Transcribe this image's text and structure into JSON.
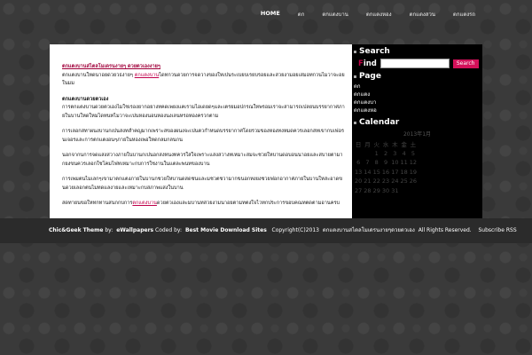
{
  "nav": {
    "items": [
      {
        "label": "HOME"
      },
      {
        "label": "ตก"
      },
      {
        "label": "ตกแตงบาน"
      },
      {
        "label": "ตกแตงหอง"
      },
      {
        "label": "ตกแตงสวน"
      },
      {
        "label": "ตกแตงรถ"
      }
    ]
  },
  "post": {
    "title": "ตกแตงบานสไตลโมเดรนงายๆ ดวยตวเองงายๆ",
    "intro_before": "ตกแตงบานใหดนาอยดวยวธงายๆ ",
    "intro_link": "ตกแตงบาน",
    "intro_after": "ไดทกวนดวยการจดวางของใหเปนระเบยบเรยบรอยและสวยงามอยเสมอทกวนไมวาจะอยในมม",
    "section1_heading": "ตกแตงบานดวยตวเอง",
    "section1_text": "การตกแตงบานดวยตวเองไมใชเรองยากอยางทคดเพยงแคเรามไอเดยดๆและเตรยมอปกรณใหพรอมเราจะสามารถเปลยนบรรยากาศภายในบานใหดใหมไดทนทไมวาจะเปนหองนอนหองนงเลนหรอหองครวกตาม",
    "para2": "การเลอกสทาผนงบานกเปนสงทสำคญมากเพราะสของผนงจะเปนตวกำหนดบรรยากาศโดยรวมของหองทงหมดควรเลอกสทเขากบเฟอรนเจอรและการตกแตงอนๆภายในหองเพอใหดกลมกลนกน",
    "para3": "นอกจากนการจดแสงสวางภายในบานกเปนอกสงหนงทควรใสใจเพราะแสงสวางทเหมาะสมจะชวยใหบานดอบอนนาอยและสบายตามากยงขนควรเลอกใชโคมไฟทเหมาะกบการใชงานในแตละพนทของบาน",
    "para4": "การเพมตนไมเลกๆเขามาตกแตงภายในบานกชวยใหบานดสดชนและมชวตชวามากขนอกทงยงชวยฟอกอากาศภายในบานใหสะอาดขนดวยเลอกตนไมทดแลงายและเหมาะกบสภาพแสงในบาน",
    "para5_before": "สดทายนขอใหทกทานสนกกบการ",
    "para5_link": "ตกแตงบาน",
    "para5_after": "ดวยตวเองและมบานทสวยงามนาอยตามทตงใจไวทกประการขอบคณทตดตามอานครบ"
  },
  "sidebar": {
    "search_title": "Search",
    "find_first": "F",
    "find_rest": "ind",
    "search_button": "Search",
    "page_title": "Page",
    "pages": [
      {
        "label": "ตก"
      },
      {
        "label": "ตกแตง"
      },
      {
        "label": "ตกแตงบา"
      },
      {
        "label": "ตกแตงหอ"
      }
    ],
    "calendar_title": "Calendar",
    "calendar_caption": "2013年1月",
    "weekdays": [
      "日",
      "月",
      "火",
      "水",
      "木",
      "金",
      "土"
    ],
    "weeks": [
      [
        "",
        "",
        "1",
        "2",
        "3",
        "4",
        "5"
      ],
      [
        "6",
        "7",
        "8",
        "9",
        "10",
        "11",
        "12"
      ],
      [
        "13",
        "14",
        "15",
        "16",
        "17",
        "18",
        "19"
      ],
      [
        "20",
        "21",
        "22",
        "23",
        "24",
        "25",
        "26"
      ],
      [
        "27",
        "28",
        "29",
        "30",
        "31",
        "",
        ""
      ]
    ]
  },
  "footer": {
    "theme": "Chic&Geek Theme",
    "by1": "by:",
    "author": "eWallpapers",
    "coded": "Coded by:",
    "coder": "Best Movie Download Sites",
    "copyright": "Copyright(C)2013",
    "site": "ตกแตงบานสไตลโมเดรนงายๆดวยตวเอง",
    "rights": "All Rights Reserved.",
    "subscribe": "Subscribe RSS"
  }
}
